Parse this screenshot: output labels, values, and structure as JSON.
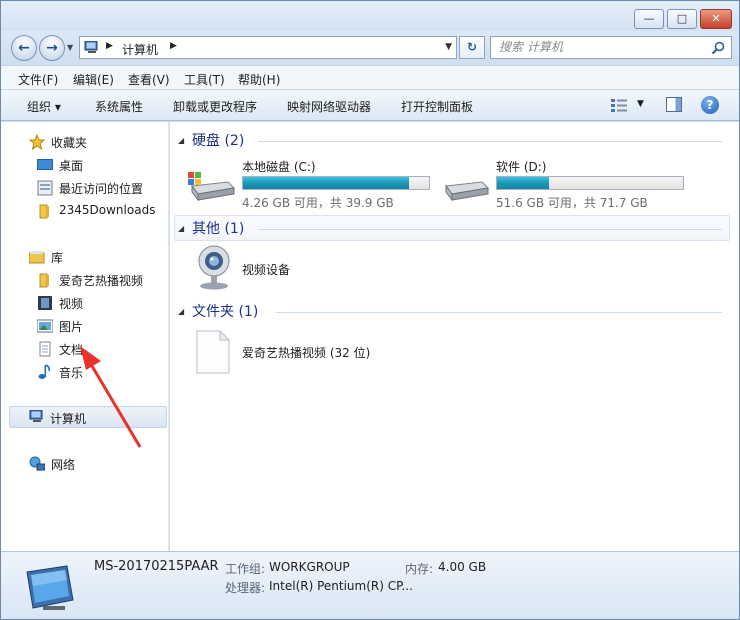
{
  "window": {
    "minimize_glyph": "—",
    "maximize_glyph": "□",
    "close_glyph": "✕"
  },
  "address_bar": {
    "crumbs": [
      "计算机"
    ],
    "back_icon": "back-arrow-icon",
    "forward_icon": "forward-arrow-icon",
    "refresh_icon": "refresh-icon"
  },
  "search": {
    "placeholder": "搜索 计算机"
  },
  "menu": [
    "文件(F)",
    "编辑(E)",
    "查看(V)",
    "工具(T)",
    "帮助(H)"
  ],
  "commands": {
    "organize": "组织 ▾",
    "items": [
      "系统属性",
      "卸载或更改程序",
      "映射网络驱动器",
      "打开控制面板"
    ]
  },
  "sidebar": {
    "favorites": {
      "label": "收藏夹",
      "items": [
        "桌面",
        "最近访问的位置",
        "2345Downloads"
      ]
    },
    "libraries": {
      "label": "库",
      "items": [
        "爱奇艺热播视频",
        "视频",
        "图片",
        "文档",
        "音乐"
      ]
    },
    "computer": "计算机",
    "network": "网络"
  },
  "groups": {
    "drives": {
      "title": "硬盘 (2)",
      "items": [
        {
          "name": "本地磁盘 (C:)",
          "size_text": "4.26 GB 可用，共 39.9 GB",
          "used_fraction": 0.893
        },
        {
          "name": "软件 (D:)",
          "size_text": "51.6 GB 可用，共 71.7 GB",
          "used_fraction": 0.28
        }
      ]
    },
    "other": {
      "title": "其他 (1)",
      "item": "视频设备"
    },
    "folders": {
      "title": "文件夹 (1)",
      "item": "爱奇艺热播视频 (32 位)"
    }
  },
  "details": {
    "pc_name": "MS-20170215PAAR",
    "workgroup_label": "工作组:",
    "workgroup_value": "WORKGROUP",
    "memory_label": "内存:",
    "memory_value": "4.00 GB",
    "cpu_label": "处理器:",
    "cpu_value": "Intel(R) Pentium(R) CP..."
  },
  "colors": {
    "accent_title": "#1e3287",
    "drive_fill": "#1996b8",
    "annotation_arrow": "#e8322b"
  }
}
